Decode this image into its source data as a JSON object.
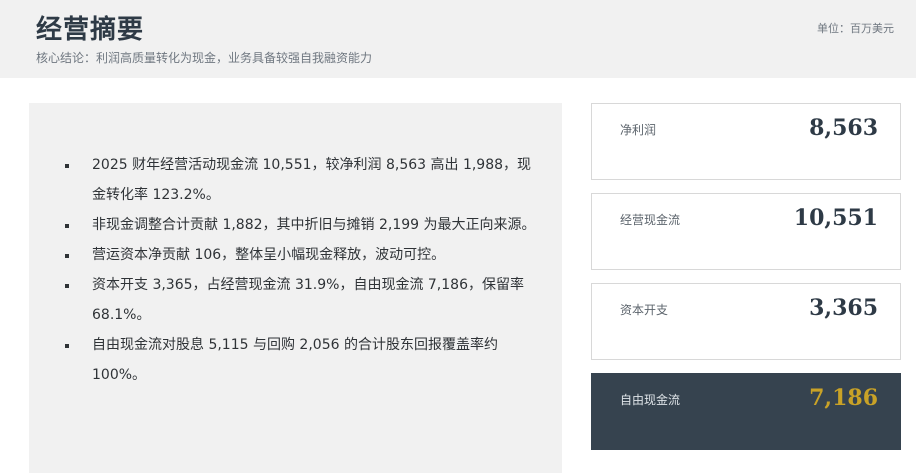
{
  "header": {
    "title": "经营摘要",
    "subtitle": "核心结论：利润高质量转化为现金，业务具备较强自我融资能力",
    "unit": "单位：百万美元"
  },
  "bullets": [
    "2025 财年经营活动现金流 10,551，较净利润 8,563 高出 1,988，现金转化率 123.2%。",
    "非现金调整合计贡献 1,882，其中折旧与摊销 2,199 为最大正向来源。",
    "营运资本净贡献 106，整体呈小幅现金释放，波动可控。",
    "资本开支 3,365，占经营现金流 31.9%，自由现金流 7,186，保留率 68.1%。",
    "自由现金流对股息 5,115 与回购 2,056 的合计股东回报覆盖率约 100%。"
  ],
  "metrics": [
    {
      "label": "净利润",
      "value": "8,563"
    },
    {
      "label": "经营现金流",
      "value": "10,551"
    },
    {
      "label": "资本开支",
      "value": "3,365"
    },
    {
      "label": "自由现金流",
      "value": "7,186"
    }
  ],
  "colors": {
    "highlight_bg": "#36434f",
    "highlight_value": "#c9a227",
    "text_dark": "#2e3a46"
  }
}
